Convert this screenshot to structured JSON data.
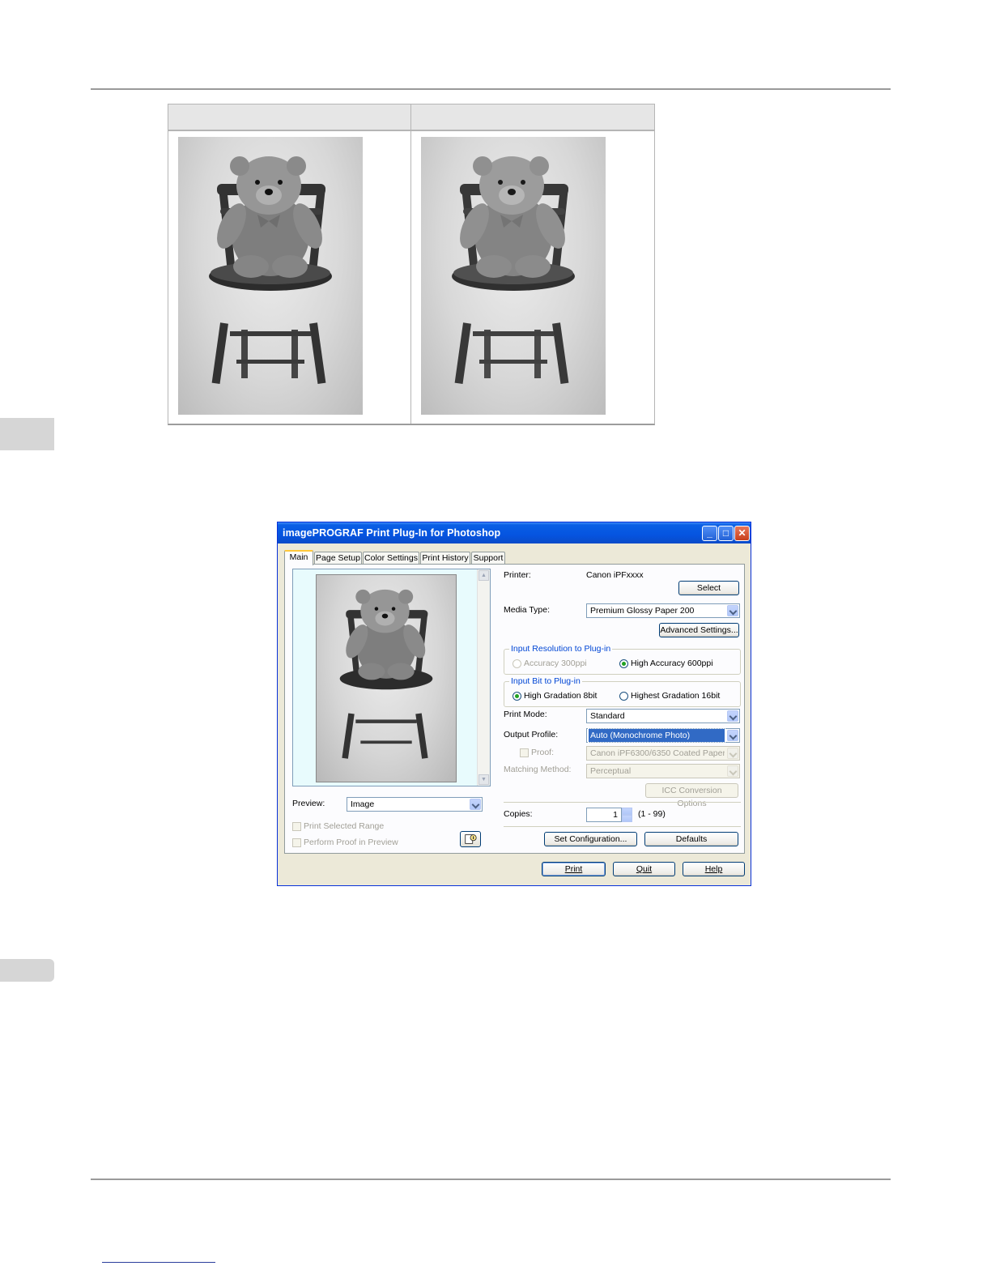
{
  "comparison": {
    "left_caption": "",
    "right_caption": ""
  },
  "dialog": {
    "title": "imagePROGRAF Print Plug-In for Photoshop",
    "tabs": [
      "Main",
      "Page Setup",
      "Color Settings",
      "Print History",
      "Support"
    ],
    "printer_label": "Printer:",
    "printer_value": "Canon iPFxxxx",
    "select_button": "Select",
    "media_type_label": "Media Type:",
    "media_type_value": "Premium Glossy Paper 200",
    "advanced_settings_button": "Advanced Settings...",
    "input_resolution_group": "Input Resolution to Plug-in",
    "resolution_options": [
      "Accuracy 300ppi",
      "High Accuracy 600ppi"
    ],
    "input_bit_group": "Input Bit to Plug-in",
    "bit_options": [
      "High Gradation 8bit",
      "Highest Gradation 16bit"
    ],
    "print_mode_label": "Print Mode:",
    "print_mode_value": "Standard",
    "output_profile_label": "Output Profile:",
    "output_profile_value": "Auto (Monochrome Photo)",
    "proof_label": "Proof:",
    "proof_value": "Canon iPF6300/6350 Coated Paper (...",
    "matching_method_label": "Matching Method:",
    "matching_method_value": "Perceptual",
    "icc_button": "ICC Conversion Options",
    "copies_label": "Copies:",
    "copies_value": "1",
    "copies_range": "(1 - 99)",
    "set_configuration_button": "Set Configuration...",
    "defaults_button": "Defaults",
    "preview_label": "Preview:",
    "preview_value": "Image",
    "print_selected_range": "Print Selected Range",
    "perform_proof": "Perform Proof in Preview",
    "print_button": "Print",
    "quit_button": "Quit",
    "help_button": "Help"
  }
}
